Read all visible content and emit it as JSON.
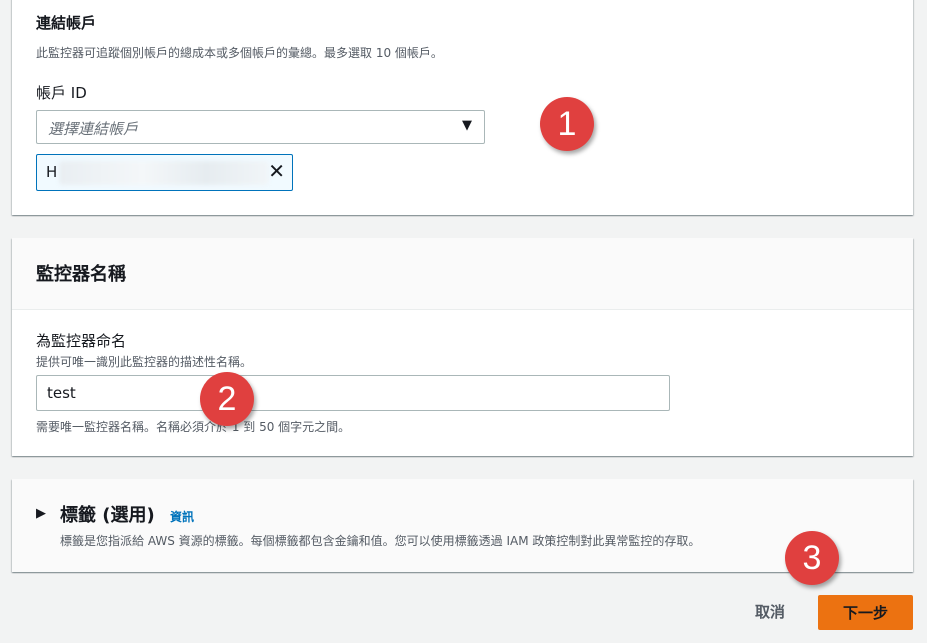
{
  "linked_accounts": {
    "title": "連結帳戶",
    "description": "此監控器可追蹤個別帳戶的總成本或多個帳戶的彙總。最多選取 10 個帳戶。",
    "field_label": "帳戶 ID",
    "select_placeholder": "選擇連結帳戶",
    "selected_token_prefix": "H"
  },
  "monitor_name": {
    "section_title": "監控器名稱",
    "field_label": "為監控器命名",
    "field_description": "提供可唯一識別此監控器的描述性名稱。",
    "value": "test",
    "constraint": "需要唯一監控器名稱。名稱必須介於 1 到 50 個字元之間。"
  },
  "tags": {
    "title": "標籤 (選用)",
    "info_link": "資訊",
    "description": "標籤是您指派給 AWS 資源的標籤。每個標籤都包含金鑰和值。您可以使用標籤透過 IAM 政策控制對此異常監控的存取。"
  },
  "footer": {
    "cancel_label": "取消",
    "next_label": "下一步"
  },
  "callouts": [
    "1",
    "2",
    "3"
  ],
  "colors": {
    "primary_button": "#ec7211",
    "link": "#0073bb",
    "callout": "#e0403f"
  }
}
